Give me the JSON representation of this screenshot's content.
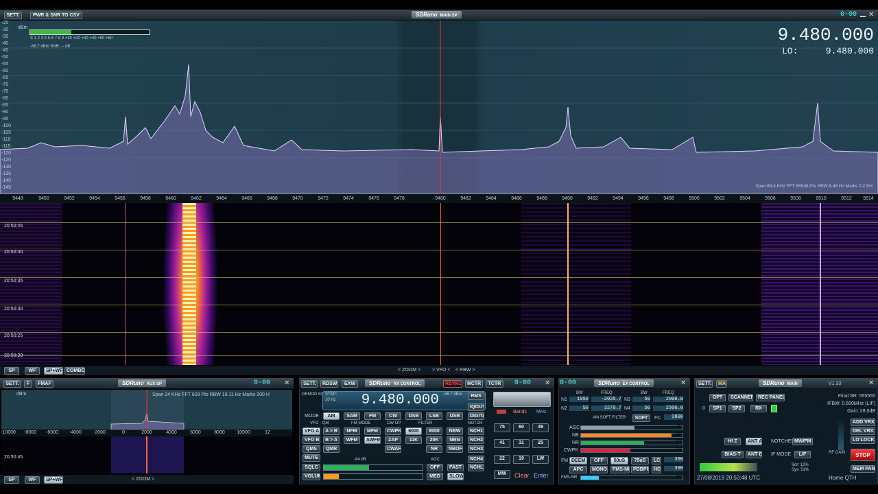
{
  "top_bar": {
    "sett_label": "SETT.",
    "pwr_snr_label": "PWR & SNR TO CSV",
    "title": "SDRuno",
    "subtitle": "MAIN SP",
    "clock": "0-00"
  },
  "main_sp": {
    "frequency": "9.480.000",
    "lo_label": "LO:",
    "lo_value": "9.480.000",
    "dbm_unit": "dBm",
    "smeter_scale": "S 1 2 3 4 5 6 7 8 9 +10 +20 +30 +40 +50 +60",
    "smeter_readout": "-88.7 dBm      SNR: -- dB",
    "y_axis": [
      "-25",
      "-30",
      "-35",
      "-40",
      "-45",
      "-50",
      "-55",
      "-60",
      "-65",
      "-70",
      "-75",
      "-80",
      "-85",
      "-90",
      "-95",
      "-100",
      "-105",
      "-110",
      "-115",
      "-120",
      "-125",
      "-130",
      "-135",
      "-140",
      "-145"
    ],
    "x_axis": [
      "9448",
      "9450",
      "9452",
      "9454",
      "9456",
      "9458",
      "9460",
      "9462",
      "9464",
      "9466",
      "9468",
      "9470",
      "9472",
      "9474",
      "9476",
      "9478",
      "9480",
      "9482",
      "9484",
      "9486",
      "9488",
      "9490",
      "9492",
      "9494",
      "9496",
      "9498",
      "9500",
      "9502",
      "9504",
      "9506",
      "9508",
      "9510",
      "9512",
      "9514"
    ],
    "info": "Span 69.4 KHz   FFT 65536 Pts   RBW 8.48 Hz   Marks 0.2 KH",
    "waterfall_times": [
      "20:50:45",
      "20:50:40",
      "20:50:35",
      "20:50:30",
      "20:50:25",
      "20:50:20"
    ],
    "bottom_sp": "SP",
    "bottom_wf": "WF",
    "bottom_spwf": "SP+WF",
    "bottom_combo": "COMBO",
    "zoom": "ZOOM",
    "vfo": "VFO",
    "rbw": "RBW"
  },
  "aux_sp": {
    "sett": "SETT.",
    "f": "F",
    "fmaf": "FMAF",
    "title": "SDRuno",
    "subtitle": "AUX SP",
    "clock": "0-00",
    "dbm": "dBm",
    "info": "Span 24 KHz   FFT 628 Pts   RBW 19.11 Hz   Marks 200 H",
    "x_axis": [
      "-10000",
      "-8000",
      "-6000",
      "-4000",
      "-2000",
      "0",
      "2000",
      "4000",
      "6000",
      "8000",
      "10000",
      "12"
    ],
    "time": "20:50:45",
    "sp": "SP",
    "wf": "WF",
    "spwf": "SP+WF",
    "zoom": "ZOOM"
  },
  "rx_control": {
    "sett": "SETT.",
    "rdsw": "RDSW",
    "exw": "EXW",
    "title": "SDRuno",
    "subtitle": "RX CONTROL",
    "rsyn": "RSYN1",
    "mctr": "MCTR",
    "tctr": "TCTR",
    "clock": "0-00",
    "demod_label": "DEMOD 50u",
    "step_label": "STEP:",
    "step_value": "10 Hz",
    "frequency": "9.480.000",
    "level": "-86.7 dBm",
    "rms": "RMS",
    "iqout": "IQOUT",
    "digital": "DIGITAL",
    "mode_label": "MODE",
    "modes": [
      "AM",
      "SAM",
      "FM",
      "CW",
      "DSB",
      "LSB",
      "USB"
    ],
    "vfo_qm": "VFO - QM",
    "fm_mode": "FM MODE",
    "cw_op": "CW OP",
    "filter": "FILTER",
    "notch": "NOTCH",
    "row1": [
      "VFO A",
      "A > B",
      "NFM",
      "MFM",
      "CWPK",
      "6000",
      "8000",
      "NBW",
      "NCH1"
    ],
    "row2": [
      "VFO B",
      "B > A",
      "WFM",
      "SWFM",
      "ZAP",
      "11K",
      "20K",
      "NBN",
      "NCH2"
    ],
    "row3": [
      "QMS",
      "QMR",
      "CWAFC",
      "NR",
      "NBOFF",
      "NCH3"
    ],
    "mute": "MUTE",
    "sqlc": "SQLC",
    "sqlc_level": "-84 dB",
    "agc": "AGC",
    "agc_off": "OFF",
    "agc_fast": "FAST",
    "agc_med": "MED",
    "agc_slow": "SLOW",
    "nch4": "NCH4",
    "nchl": "NCHL",
    "volume": "VOLUME",
    "bands": "Bands",
    "mhz": "MHz",
    "band_buttons": [
      "75",
      "60",
      "49",
      "41",
      "31",
      "25",
      "22",
      "19",
      "LW",
      "MW"
    ],
    "clear": "Clear",
    "enter": "Enter"
  },
  "ex_control": {
    "clock": "0-00",
    "title": "SDRuno",
    "subtitle": "EX CONTROL",
    "bw": "BW",
    "freq": "FREQ",
    "bw2": "BW",
    "freq2": "FREQ",
    "n1": "N1",
    "n1_bw": "1050",
    "n1_freq": "-2025.7",
    "n3": "N3",
    "n3_bw": "50",
    "n3_freq": "2000.0",
    "n2": "N2",
    "n2_bw": "50",
    "n2_freq": "3279.7",
    "n4": "N4",
    "n4_bw": "50",
    "n4_freq": "2500.0",
    "am_soft_filter": "AM SOFT FILTER",
    "soft": "SOFT",
    "fc": "FC",
    "fc_value": "3800",
    "agc": "AGC",
    "agc_v": "78",
    "nb": "NB",
    "nb_v": "197",
    "nr": "NR",
    "nr_v": "93",
    "cwpk": "CWPK",
    "cwpk_v": "103",
    "fm": "FM",
    "deem": "DEEM",
    "off": "OFF",
    "us50": "50uS",
    "us75": "75uS",
    "lc": "LC",
    "lc_v": "300",
    "apc": "APC",
    "mono": "MONO",
    "fms_nr": "FMS-NR",
    "pdbpf": "PDBPF",
    "hc": "HC",
    "hc_v": "300",
    "fms_nr2": "FMS-NR",
    "fms_v": "40"
  },
  "main_panel": {
    "sett": "SETT.",
    "ma": "MA",
    "title": "SDRuno",
    "subtitle": "MAIN",
    "version": "V1.33",
    "final_sr": "Final SR: 555555",
    "ifbw": "IFBW: 0.600MHz (LIF)",
    "gain": "Gain: 28.0dB",
    "opt": "OPT",
    "scanner": "SCANNER",
    "rec_panel": "REC PANEL",
    "zero": "0",
    "sp1": "SP1",
    "sp2": "SP2",
    "rx": "RX",
    "add_vrx": "ADD VRX",
    "del_vrx": "DEL VRX",
    "lo_lock": "LO LOCK",
    "hiz": "HI Z",
    "ant_a": "ANT A",
    "notches": "NOTCHES",
    "mw_fm": "MW/FM",
    "bias_t": "BIAS-T",
    "ant_b": "ANT B",
    "if_mode": "IF MODE",
    "lif": "LIF",
    "rf_gain": "RF GAIN",
    "stop": "STOP",
    "sdr": "Sdr: 12%",
    "sys": "Sys: 51%",
    "mem_pan": "MEM PAN",
    "datetime": "27/08/2019 20:50:48 UTC",
    "qth": "Home QTH"
  },
  "colors": {
    "accent": "#38cfff",
    "signal_green": "#2ecc40",
    "stop_red": "#d60000"
  }
}
